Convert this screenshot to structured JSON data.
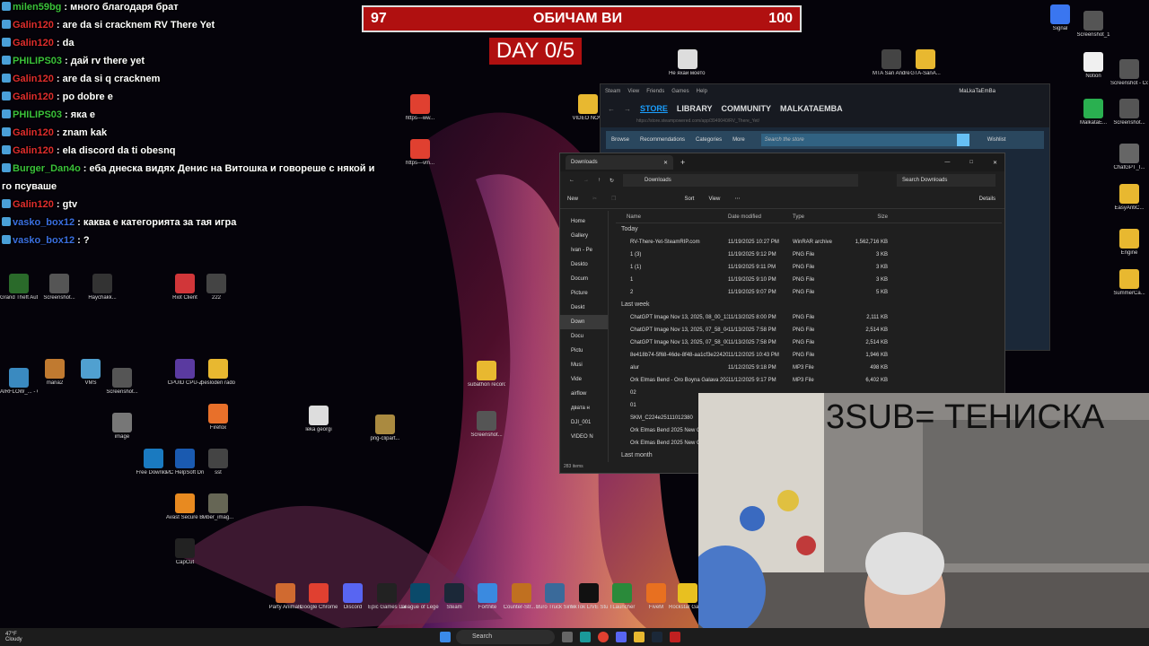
{
  "overlay": {
    "hp_left": "97",
    "hp_title": "ОБИЧАМ ВИ",
    "hp_right": "100",
    "day_counter": "DAY 0/5"
  },
  "chat": [
    {
      "user": "milen59bg",
      "msg": "много благодаря брат",
      "color": "#3ac13a"
    },
    {
      "user": "Galin120",
      "msg": "are da si cracknem RV There Yet",
      "color": "#e02d2d"
    },
    {
      "user": "Galin120",
      "msg": "da",
      "color": "#e02d2d"
    },
    {
      "user": "PHILIPS03",
      "msg": "дай rv there yet",
      "color": "#3ac13a"
    },
    {
      "user": "Galin120",
      "msg": "are da si q cracknem",
      "color": "#e02d2d"
    },
    {
      "user": "Galin120",
      "msg": "po dobre e",
      "color": "#e02d2d"
    },
    {
      "user": "PHILIPS03",
      "msg": "яка е",
      "color": "#3ac13a"
    },
    {
      "user": "Galin120",
      "msg": "znam kak",
      "color": "#e02d2d"
    },
    {
      "user": "Galin120",
      "msg": "ela discord da ti obesnq",
      "color": "#e02d2d"
    },
    {
      "user": "Burger_Dan4o",
      "msg": "еба днеска видях Денис на Витошка и говореше с някой и",
      "color": "#3ac13a"
    },
    {
      "user": "",
      "msg": "го псуваше",
      "color": "#ffffff"
    },
    {
      "user": "Galin120",
      "msg": "gtv",
      "color": "#e02d2d"
    },
    {
      "user": "vasko_box12",
      "msg": "каква е категорията за тая игра",
      "color": "#3a6ee0"
    },
    {
      "user": "vasko_box12",
      "msg": "?",
      "color": "#3a6ee0"
    }
  ],
  "desktop_icons": [
    {
      "label": "Grand Theft Auto V",
      "color": "#2a6a2a"
    },
    {
      "label": "Screenshot...",
      "color": "#555"
    },
    {
      "label": "Haychakk...",
      "color": "#333"
    },
    {
      "label": "Riot Client",
      "color": "#d13639"
    },
    {
      "label": "222",
      "color": "#444"
    },
    {
      "label": "AIRFLOW_... - Copy",
      "color": "#3a8ac0"
    },
    {
      "label": "maria2",
      "color": "#c07a30"
    },
    {
      "label": "VMS",
      "color": "#50a0d0"
    },
    {
      "label": "Screenshot...",
      "color": "#555"
    },
    {
      "label": "CPUID CPU-Z",
      "color": "#5a3aa0"
    },
    {
      "label": "pesloden rado",
      "color": "#e8b830"
    },
    {
      "label": "image",
      "color": "#777"
    },
    {
      "label": "Firefox",
      "color": "#e8702a"
    },
    {
      "label": "Free Downlo...",
      "color": "#1a7ac0"
    },
    {
      "label": "PC HelpSoft Driver Up...",
      "color": "#1a5ab0"
    },
    {
      "label": "sst",
      "color": "#444"
    },
    {
      "label": "Avast Secure Browser",
      "color": "#e88a20"
    },
    {
      "label": "viber_imag...",
      "color": "#665"
    },
    {
      "label": "CapCut",
      "color": "#222"
    },
    {
      "label": "Party Animals",
      "color": "#d06a30"
    },
    {
      "label": "Google Chrome",
      "color": "#e04030"
    },
    {
      "label": "Discord",
      "color": "#5865f2"
    },
    {
      "label": "Epic Games Launcher",
      "color": "#222"
    },
    {
      "label": "League of Legends",
      "color": "#0a4a6a"
    },
    {
      "label": "Steam",
      "color": "#1b2838"
    },
    {
      "label": "Fortnite",
      "color": "#3a8ae0"
    },
    {
      "label": "Counter-Str... 2",
      "color": "#c07020"
    },
    {
      "label": "Euro Truck Simulator 2",
      "color": "#3a6a9a"
    },
    {
      "label": "TikTok LIVE Studio",
      "color": "#111"
    },
    {
      "label": "TLauncher",
      "color": "#2a8a3a"
    },
    {
      "label": "FiveM",
      "color": "#e87020"
    },
    {
      "label": "Rockstar Games ...",
      "color": "#e8c020"
    },
    {
      "label": "MTA San Andreas 1.6",
      "color": "#444"
    },
    {
      "label": "GTA-SanA...",
      "color": "#e8b830"
    },
    {
      "label": "Signal",
      "color": "#3a76f0"
    },
    {
      "label": "Screenshot_1",
      "color": "#555"
    },
    {
      "label": "Notion",
      "color": "#f0f0f0"
    },
    {
      "label": "Screenshot - Copy",
      "color": "#555"
    },
    {
      "label": "MalkataE...",
      "color": "#2ab050"
    },
    {
      "label": "Screenshot...",
      "color": "#555"
    },
    {
      "label": "ChatGPT_I...",
      "color": "#666"
    },
    {
      "label": "EasyAntiC...",
      "color": "#e8b830"
    },
    {
      "label": "Engine",
      "color": "#e8b830"
    },
    {
      "label": "SummerCa...",
      "color": "#e8b830"
    },
    {
      "label": "subathon record",
      "color": "#e8b830"
    },
    {
      "label": "leka georgi",
      "color": "#ddd"
    },
    {
      "label": "png-clipart...",
      "color": "#aa8a40"
    },
    {
      "label": "Screenshot...",
      "color": "#555"
    },
    {
      "label": "Не яхай моето мо...",
      "color": "#ddd"
    },
    {
      "label": "VIDEO NOW",
      "color": "#e8b830"
    },
    {
      "label": "https---ww...",
      "color": "#e04030"
    },
    {
      "label": "https---vm...",
      "color": "#e04030"
    }
  ],
  "steam": {
    "menu": [
      "Steam",
      "View",
      "Friends",
      "Games",
      "Help"
    ],
    "account": "MaLkaTaEmBa",
    "tabs": [
      "STORE",
      "LIBRARY",
      "COMMUNITY",
      "MALKATAEMBA"
    ],
    "url": "https://store.steampowered.com/app/3949040/RV_There_Yet/",
    "store_nav": [
      "Browse",
      "Recommendations",
      "Categories",
      "More"
    ],
    "search_placeholder": "Search the store",
    "wishlist": "Wishlist"
  },
  "explorer": {
    "tab_title": "Downloads",
    "path": "Downloads",
    "search_placeholder": "Search Downloads",
    "toolbar": [
      "New",
      "Sort",
      "View",
      "Details"
    ],
    "nav": [
      "Home",
      "Gallery",
      "Ivan - Pe",
      "Deskto",
      "Docum",
      "Picture",
      "Deskt",
      "Down",
      "Docu",
      "Pictu",
      "Musi",
      "Vide",
      "airflow",
      "двата н",
      "DJI_001",
      "VIDEO N"
    ],
    "columns": [
      "Name",
      "Date modified",
      "Type",
      "Size"
    ],
    "groups": [
      {
        "title": "Today",
        "files": [
          {
            "name": "RV-There-Yet-SteamRIP.com",
            "date": "11/19/2025 10:27 PM",
            "type": "WinRAR archive",
            "size": "1,562,716 KB"
          },
          {
            "name": "1 (3)",
            "date": "11/19/2025 9:12 PM",
            "type": "PNG File",
            "size": "3 KB"
          },
          {
            "name": "1 (1)",
            "date": "11/19/2025 9:11 PM",
            "type": "PNG File",
            "size": "3 KB"
          },
          {
            "name": "1",
            "date": "11/19/2025 9:10 PM",
            "type": "PNG File",
            "size": "3 KB"
          },
          {
            "name": "2",
            "date": "11/19/2025 9:07 PM",
            "type": "PNG File",
            "size": "5 KB"
          }
        ]
      },
      {
        "title": "Last week",
        "files": [
          {
            "name": "ChatGPT Image Nov 13, 2025, 08_00_13 PM",
            "date": "11/13/2025 8:00 PM",
            "type": "PNG File",
            "size": "2,111 KB"
          },
          {
            "name": "ChatGPT Image Nov 13, 2025, 07_58_04 PM",
            "date": "11/13/2025 7:58 PM",
            "type": "PNG File",
            "size": "2,514 KB"
          },
          {
            "name": "ChatGPT Image Nov 13, 2025, 07_58_00 PM",
            "date": "11/13/2025 7:58 PM",
            "type": "PNG File",
            "size": "2,514 KB"
          },
          {
            "name": "8e418b74-5f68-46de-8f48-aa1cf3e22420",
            "date": "11/12/2025 10:43 PM",
            "type": "PNG File",
            "size": "1,946 KB"
          },
          {
            "name": "alur",
            "date": "11/12/2025 9:18 PM",
            "type": "MP3 File",
            "size": "498 KB"
          },
          {
            "name": "Ork Elmas Bend - Oro Boyna Galava 2025...",
            "date": "11/12/2025 9:17 PM",
            "type": "MP3 File",
            "size": "6,402 KB"
          },
          {
            "name": "02",
            "date": "",
            "type": "",
            "size": ""
          },
          {
            "name": "01",
            "date": "",
            "type": "",
            "size": ""
          },
          {
            "name": "SKM_C224e25111012380",
            "date": "",
            "type": "",
            "size": ""
          },
          {
            "name": "Ork Elmas Bend 2025 New Or",
            "date": "",
            "type": "",
            "size": ""
          },
          {
            "name": "Ork Elmas Bend 2025 New Or",
            "date": "",
            "type": "",
            "size": ""
          }
        ]
      },
      {
        "title": "Last month",
        "files": []
      }
    ],
    "status": "283 items"
  },
  "webcam": {
    "title": "3SUB= ТЕНИСКА"
  },
  "taskbar": {
    "temperature": "47°F",
    "weather": "Cloudy",
    "search": "Search"
  }
}
